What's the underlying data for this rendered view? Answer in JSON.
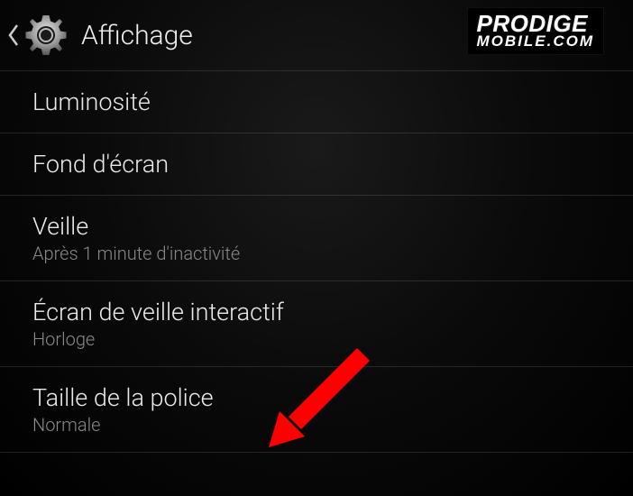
{
  "header": {
    "title": "Affichage"
  },
  "logo": {
    "line1": "PRODIGE",
    "line2": "MOBILE.COM"
  },
  "settings": [
    {
      "title": "Luminosité",
      "subtitle": null
    },
    {
      "title": "Fond d'écran",
      "subtitle": null
    },
    {
      "title": "Veille",
      "subtitle": "Après 1 minute d'inactivité"
    },
    {
      "title": "Écran de veille interactif",
      "subtitle": "Horloge"
    },
    {
      "title": "Taille de la police",
      "subtitle": "Normale"
    }
  ],
  "annotation": {
    "arrow_color": "#ff0000"
  }
}
